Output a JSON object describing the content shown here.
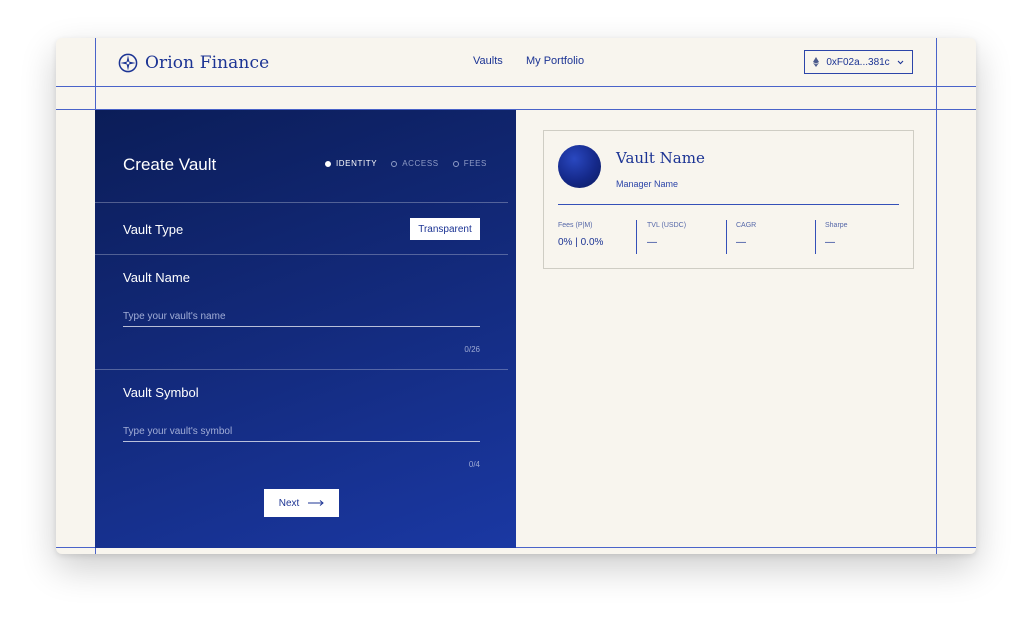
{
  "header": {
    "brand": "Orion Finance",
    "nav": [
      {
        "label": "Vaults"
      },
      {
        "label": "My Portfolio"
      }
    ],
    "wallet": {
      "address": "0xF02a...381c"
    }
  },
  "form": {
    "title": "Create Vault",
    "steps": [
      {
        "label": "IDENTITY",
        "active": true
      },
      {
        "label": "ACCESS",
        "active": false
      },
      {
        "label": "FEES",
        "active": false
      }
    ],
    "vault_type": {
      "label": "Vault Type",
      "value": "Transparent"
    },
    "vault_name": {
      "label": "Vault Name",
      "placeholder": "Type your vault's name",
      "value": "",
      "counter": "0/26"
    },
    "vault_symbol": {
      "label": "Vault Symbol",
      "placeholder": "Type your vault's symbol",
      "value": "",
      "counter": "0/4"
    },
    "next_label": "Next"
  },
  "preview": {
    "name": "Vault Name",
    "manager": "Manager Name",
    "stats": [
      {
        "label": "Fees (P|M)",
        "value": "0% | 0.0%"
      },
      {
        "label": "TVL (USDC)",
        "value": "—"
      },
      {
        "label": "CAGR",
        "value": "—"
      },
      {
        "label": "Sharpe",
        "value": "—"
      }
    ]
  },
  "colors": {
    "accent": "#1c3494",
    "background": "#f8f5ee",
    "panel_start": "#0b1d58",
    "panel_end": "#1a38a3",
    "guide": "#4a63c9"
  }
}
